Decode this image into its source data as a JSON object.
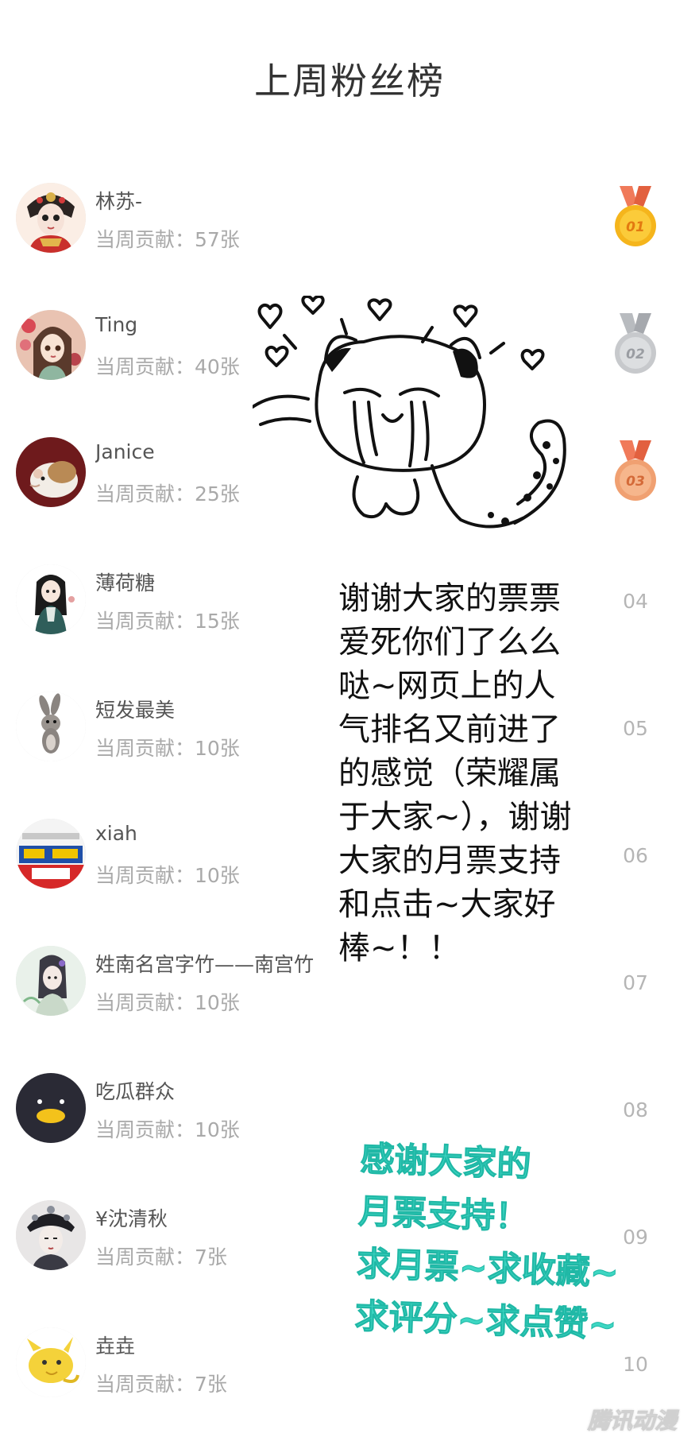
{
  "header": {
    "title": "上周粉丝榜"
  },
  "fans": [
    {
      "name": "林苏-",
      "contribution": "当周贡献：57张",
      "rank": "01",
      "medal": "gold",
      "avatar": "avatar-bride"
    },
    {
      "name": "Ting",
      "contribution": "当周贡献：40张",
      "rank": "02",
      "medal": "silver",
      "avatar": "avatar-anime-girl"
    },
    {
      "name": "Janice",
      "contribution": "当周贡献：25张",
      "rank": "03",
      "medal": "bronze",
      "avatar": "avatar-hamster"
    },
    {
      "name": "薄荷糖",
      "contribution": "当周贡献：15张",
      "rank": "04",
      "medal": null,
      "avatar": "avatar-ancient-girl"
    },
    {
      "name": "短发最美",
      "contribution": "当周贡献：10张",
      "rank": "05",
      "medal": null,
      "avatar": "avatar-rabbit"
    },
    {
      "name": "xiah",
      "contribution": "当周贡献：10张",
      "rank": "06",
      "medal": null,
      "avatar": "avatar-banner"
    },
    {
      "name": "姓南名宫字竹——南宫竹",
      "contribution": "当周贡献：10张",
      "rank": "07",
      "medal": null,
      "avatar": "avatar-ink-portrait"
    },
    {
      "name": "吃瓜群众",
      "contribution": "当周贡献：10张",
      "rank": "08",
      "medal": null,
      "avatar": "avatar-penguin"
    },
    {
      "name": "¥沈清秋",
      "contribution": "当周贡献：7张",
      "rank": "09",
      "medal": null,
      "avatar": "avatar-headdress"
    },
    {
      "name": "垚垚",
      "contribution": "当周贡献：7张",
      "rank": "10",
      "medal": null,
      "avatar": "avatar-yellow-creature"
    }
  ],
  "overlay": {
    "message": "谢谢大家的票票爱死你们了么么哒~网页上的人气排名又前进了的感觉（荣耀属于大家~），谢谢大家的月票支持和点击~大家好棒~！！",
    "promo_lines": [
      "感谢大家的",
      "月票支持！",
      "求月票~求收藏~",
      "求评分~求点赞~"
    ],
    "watermark": "腾讯动漫"
  },
  "colors": {
    "gold": "#f5b51c",
    "silver": "#c7c9cc",
    "bronze": "#f0a071",
    "promo": "#3dd6c2"
  }
}
